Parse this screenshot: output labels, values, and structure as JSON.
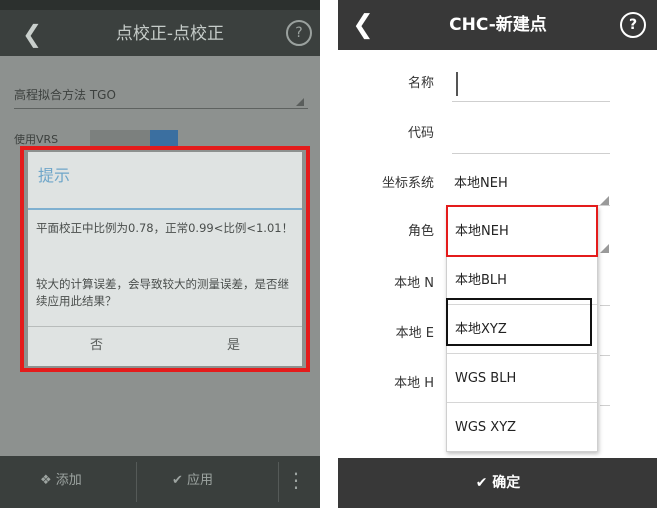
{
  "left": {
    "title": "点校正-点校正",
    "back_icon": "chevron-left-icon",
    "help_label": "?",
    "row_label": "高程拟合方法  TGO",
    "vrs_label": "使用VRS",
    "dialog": {
      "title": "提示",
      "message1": "平面校正中比例为0.78，正常0.99<比例<1.01！",
      "message2": "较大的计算误差，会导致较大的测量误差，是否继续应用此结果？",
      "no_label": "否",
      "yes_label": "是"
    },
    "bottom": {
      "add_label": "添加",
      "apply_label": "应用",
      "more_label": "⋮"
    }
  },
  "right": {
    "title": "CHC-新建点",
    "help_label": "?",
    "fields": {
      "name_label": "名称",
      "code_label": "代码",
      "coord_system_label": "坐标系统",
      "coord_system_value": "本地NEH",
      "role_label": "角色",
      "local_n_label": "本地 N",
      "local_e_label": "本地 E",
      "local_h_label": "本地 H"
    },
    "dropdown_options": [
      "本地NEH",
      "本地BLH",
      "本地XYZ",
      "WGS BLH",
      "WGS XYZ"
    ],
    "confirm_label": "确定"
  },
  "colors": {
    "highlight_red": "#e41b1b",
    "highlight_black": "#111111",
    "titlebar_dark": "#383838",
    "dialog_accent": "#6fa6c9"
  }
}
